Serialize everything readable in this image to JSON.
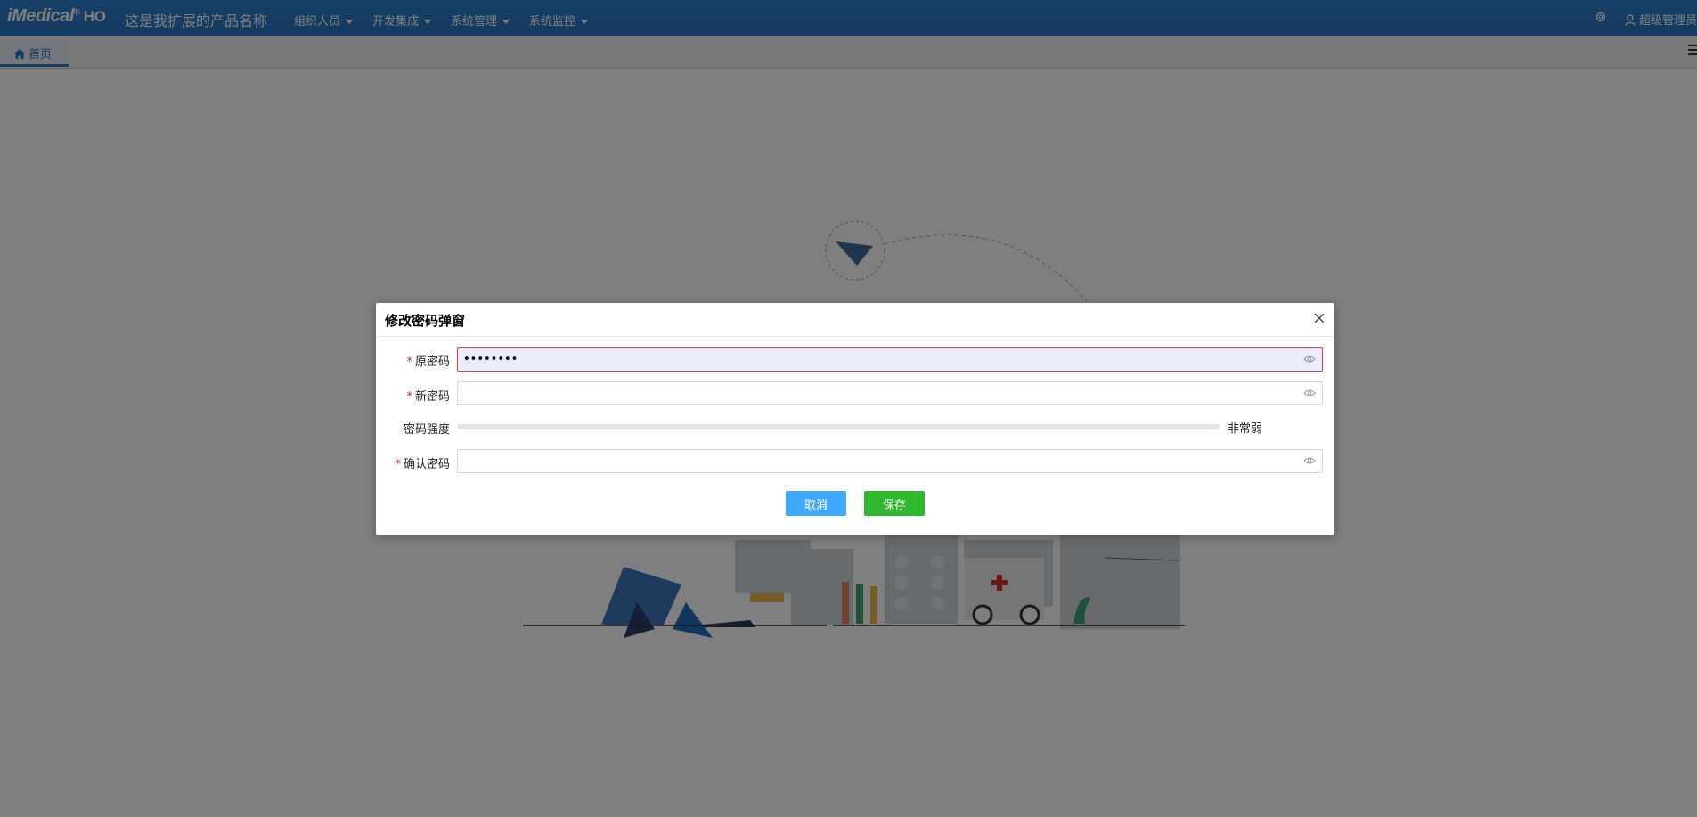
{
  "header": {
    "brand": "iMedical",
    "brand_reg": "®",
    "brand_suffix": "HO",
    "product_name": "这是我扩展的产品名称",
    "menus": [
      {
        "label": "组织人员"
      },
      {
        "label": "开发集成"
      },
      {
        "label": "系统管理"
      },
      {
        "label": "系统监控"
      }
    ],
    "user": "超级管理员"
  },
  "tabs": [
    {
      "label": "首页",
      "icon": "home-icon",
      "active": true
    }
  ],
  "dialog": {
    "title": "修改密码弹窗",
    "fields": {
      "old_password": {
        "label": "原密码",
        "required": true,
        "value": "••••••••"
      },
      "new_password": {
        "label": "新密码",
        "required": true,
        "value": ""
      },
      "strength": {
        "label": "密码强度",
        "value_text": "非常弱",
        "level": 0
      },
      "confirm_password": {
        "label": "确认密码",
        "required": true,
        "value": ""
      }
    },
    "buttons": {
      "cancel": "取消",
      "save": "保存"
    }
  },
  "colors": {
    "header_bg": "#2a74c2",
    "error_border": "#e53535",
    "cancel_btn": "#40a9ff",
    "save_btn": "#2eb82e"
  }
}
